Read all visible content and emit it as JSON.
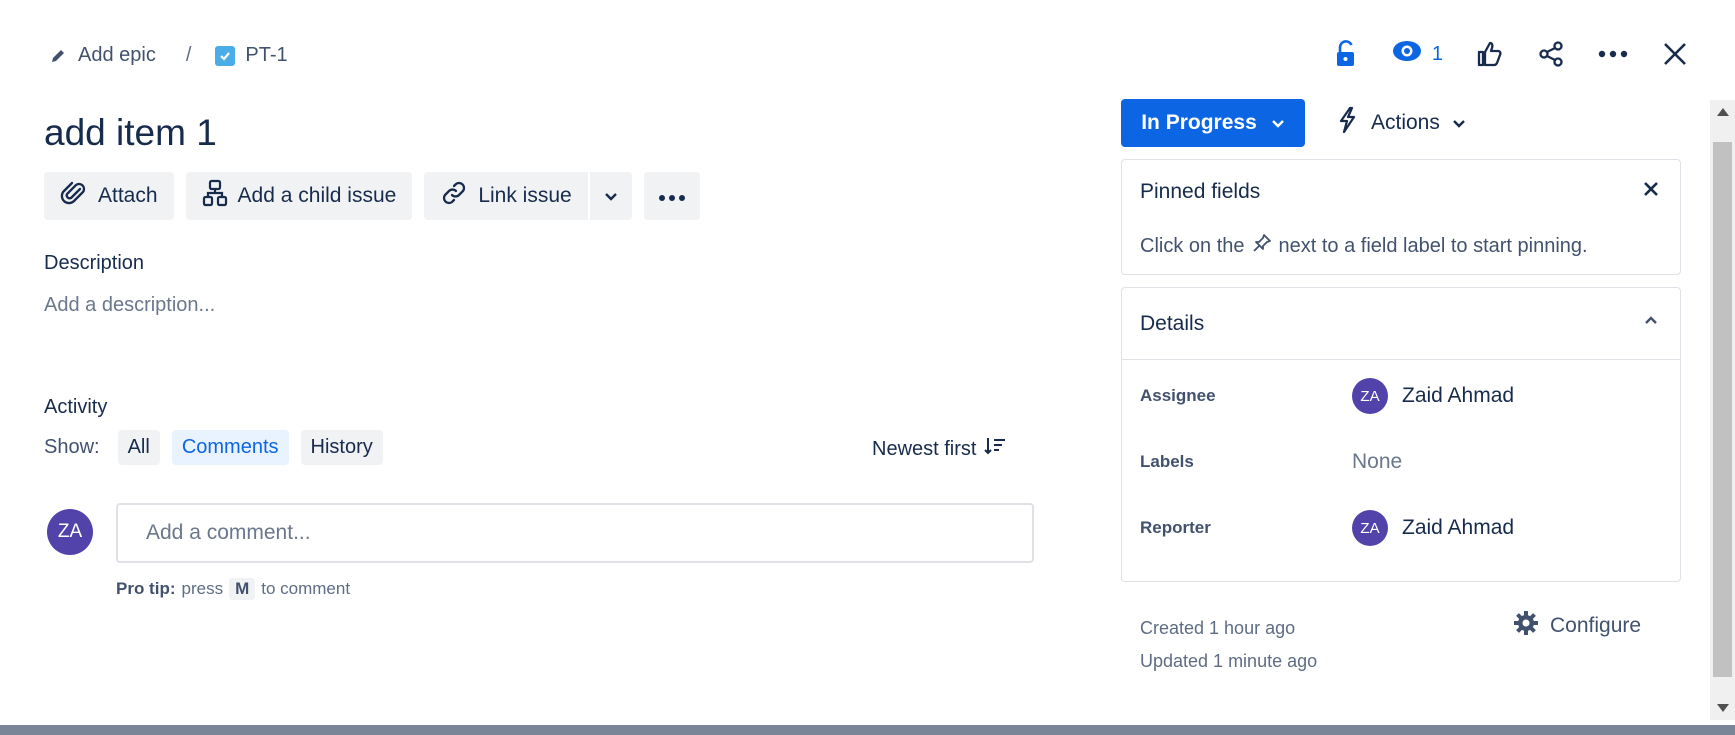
{
  "breadcrumb": {
    "epic_label": "Add epic",
    "separator": "/",
    "issue_key": "PT-1"
  },
  "top_actions": {
    "watch_count": "1"
  },
  "issue": {
    "title": "add item 1"
  },
  "toolbar": {
    "attach_label": "Attach",
    "child_issue_label": "Add a child issue",
    "link_issue_label": "Link issue"
  },
  "description": {
    "label": "Description",
    "placeholder": "Add a description..."
  },
  "activity": {
    "label": "Activity",
    "show_label": "Show:",
    "filters": [
      "All",
      "Comments",
      "History"
    ],
    "active_filter": "Comments",
    "sort_label": "Newest first"
  },
  "comment": {
    "avatar_initials": "ZA",
    "placeholder": "Add a comment...",
    "protip_bold": "Pro tip:",
    "protip_press": "press",
    "protip_key": "M",
    "protip_suffix": "to comment"
  },
  "status": {
    "label": "In Progress",
    "actions_label": "Actions"
  },
  "pinned": {
    "title": "Pinned fields",
    "text_before": "Click on the",
    "text_after": "next to a field label to start pinning."
  },
  "details": {
    "title": "Details",
    "fields": [
      {
        "label": "Assignee",
        "initials": "ZA",
        "value": "Zaid Ahmad"
      },
      {
        "label": "Labels",
        "value": "None"
      },
      {
        "label": "Reporter",
        "initials": "ZA",
        "value": "Zaid Ahmad"
      }
    ]
  },
  "meta": {
    "created": "Created 1 hour ago",
    "updated": "Updated 1 minute ago",
    "configure_label": "Configure"
  },
  "colors": {
    "primary": "#0c66e4",
    "avatar": "#5243aa",
    "text": "#172b4d",
    "subtle_bg": "#f1f2f4"
  }
}
